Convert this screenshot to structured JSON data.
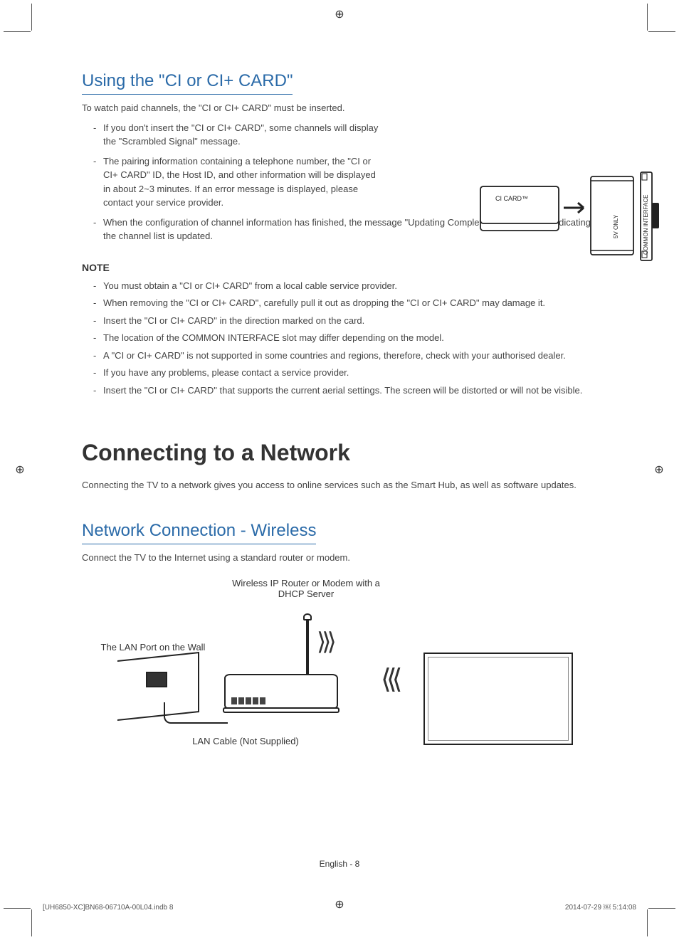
{
  "section1": {
    "heading": "Using the \"CI or CI+ CARD\"",
    "intro": "To watch paid channels, the \"CI or CI+ CARD\" must be inserted.",
    "bullets": [
      "If you don't insert the \"CI or CI+ CARD\", some channels will display the \"Scrambled Signal\" message.",
      "The pairing information containing a telephone number, the \"CI or CI+ CARD\" ID, the Host ID, and other information will be displayed in about 2~3 minutes. If an error message is displayed, please contact your service provider.",
      "When the configuration of channel information has finished, the message \"Updating Completed\" is displayed, indicating the channel list is updated."
    ],
    "note_head": "NOTE",
    "notes": [
      "You must obtain a \"CI or CI+ CARD\" from a local cable service provider.",
      "When removing the \"CI or CI+ CARD\", carefully pull it out as dropping the \"CI or CI+ CARD\" may damage it.",
      "Insert the \"CI or CI+ CARD\" in the direction marked on the card.",
      "The location of the COMMON INTERFACE slot may differ depending on the model.",
      "A \"CI or CI+ CARD\" is not supported in some countries and regions, therefore, check with your authorised dealer.",
      "If you have any problems, please contact a service provider.",
      "Insert the \"CI or CI+ CARD\" that supports the current aerial settings. The screen will be distorted or will not be visible."
    ],
    "diagram": {
      "card_label": "CI CARD™",
      "slot_label_1": "5V ONLY",
      "slot_label_2": "COMMON INTERFACE"
    }
  },
  "section2": {
    "heading": "Connecting to a Network",
    "intro": "Connecting the TV to a network gives you access to online services such as the Smart Hub, as well as software updates."
  },
  "section3": {
    "heading": "Network Connection - Wireless",
    "intro": "Connect the TV to the Internet using a standard router or modem.",
    "figure": {
      "router_label": "Wireless IP Router or Modem with a DHCP Server",
      "wall_label": "The LAN Port on the Wall",
      "cable_label": "LAN Cable (Not Supplied)"
    }
  },
  "footer": {
    "page": "English - 8",
    "file": "[UH6850-XC]BN68-06710A-00L04.indb   8",
    "timestamp": "2014-07-29   ￼ 5:14:08"
  }
}
